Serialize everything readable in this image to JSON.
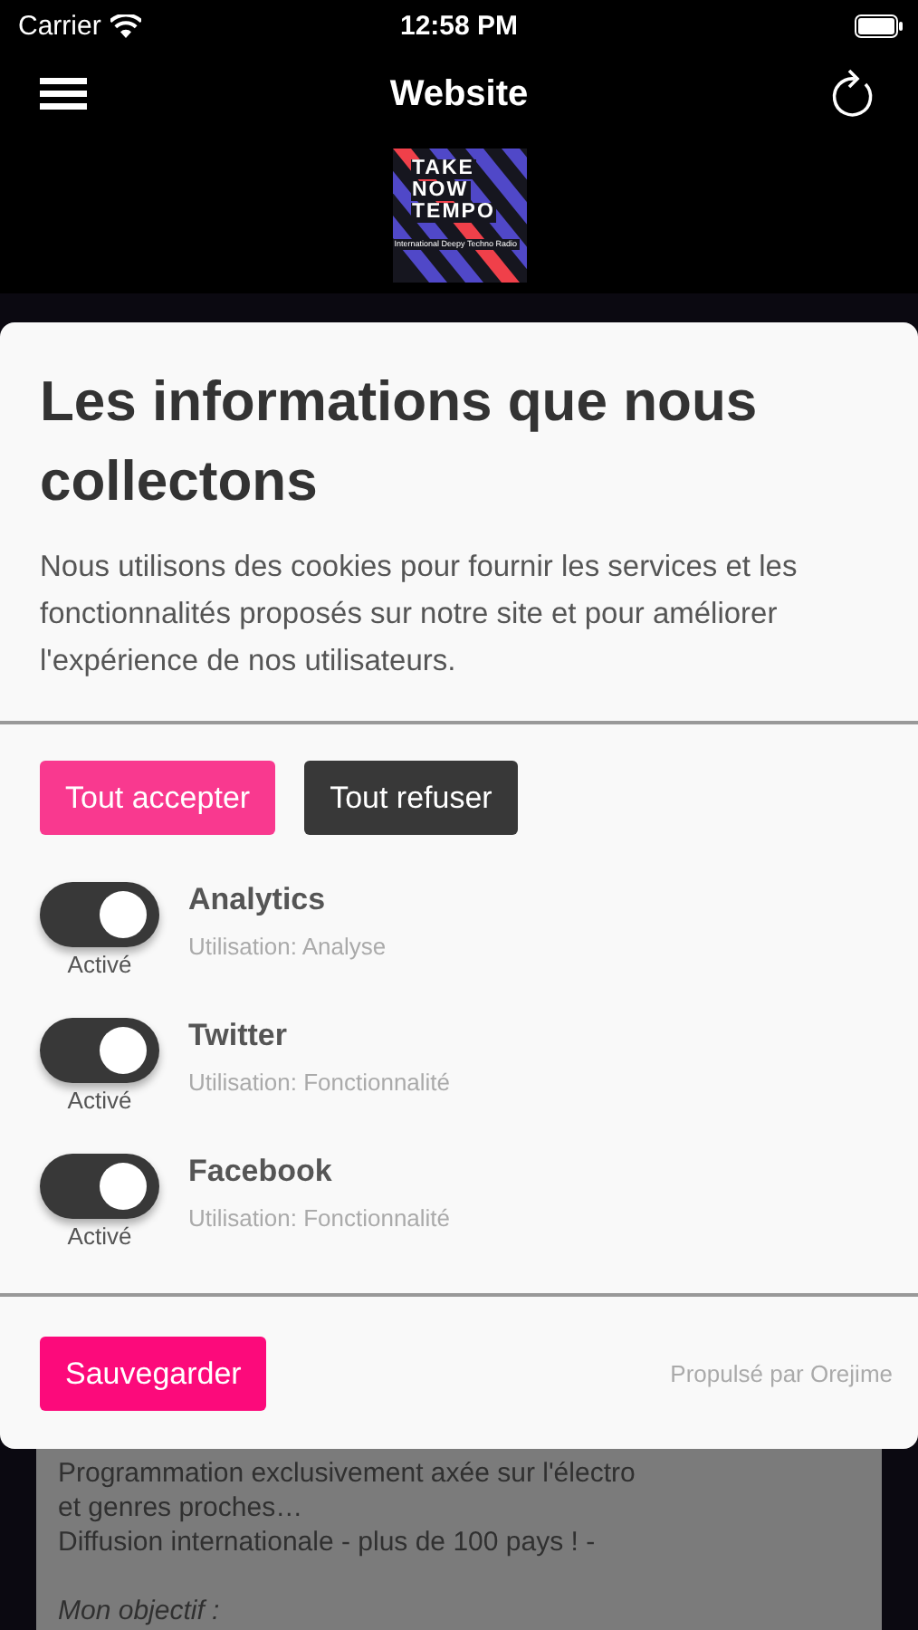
{
  "status_bar": {
    "carrier": "Carrier",
    "time": "12:58 PM"
  },
  "nav": {
    "title": "Website"
  },
  "logo": {
    "lines": [
      "TAKE",
      "NOW",
      "TEMPO"
    ],
    "tagline": "International Deepy Techno Radio"
  },
  "background_paragraphs": [
    {
      "italic": false,
      "lines": [
        "Programmation exclusivement axée sur l'électro",
        "et genres proches…",
        "Diffusion internationale - plus de 100 pays ! -"
      ]
    },
    {
      "italic": true,
      "lines": [
        "Mon objectif :"
      ]
    }
  ],
  "consent": {
    "title": "Les informations que nous collectons",
    "description": "Nous utilisons des cookies pour fournir les services et les fonctionnalités proposés sur notre site et pour améliorer l'expérience de nos utilisateurs.",
    "actions": [
      {
        "label": "Tout accepter",
        "kind": "accept"
      },
      {
        "label": "Tout refuser",
        "kind": "decline"
      }
    ],
    "purposes": [
      {
        "name": "Analytics",
        "usage": "Utilisation: Analyse",
        "state_label": "Activé",
        "on": true
      },
      {
        "name": "Twitter",
        "usage": "Utilisation: Fonctionnalité",
        "state_label": "Activé",
        "on": true
      },
      {
        "name": "Facebook",
        "usage": "Utilisation: Fonctionnalité",
        "state_label": "Activé",
        "on": true
      }
    ],
    "save": "Sauvegarder",
    "powered_by": "Propulsé par Orejime"
  }
}
